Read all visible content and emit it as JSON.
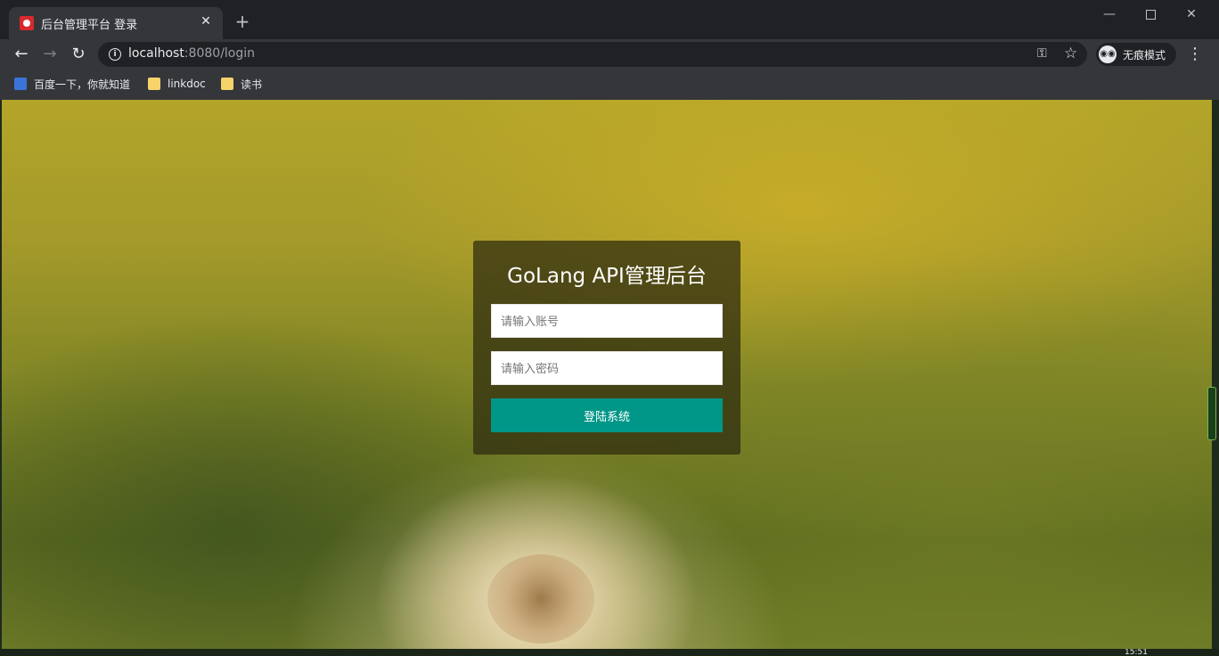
{
  "browser": {
    "tab_title": "后台管理平台 登录",
    "url_host": "localhost",
    "url_rest": ":8080/login",
    "incognito_label": "无痕模式",
    "bookmarks": [
      {
        "label": "百度一下，你就知道",
        "icon": "baidu-icon"
      },
      {
        "label": "linkdoc",
        "icon": "folder-icon"
      },
      {
        "label": "读书",
        "icon": "folder-icon"
      }
    ]
  },
  "login": {
    "title": "GoLang API管理后台",
    "username_placeholder": "请输入账号",
    "password_placeholder": "请输入密码",
    "submit_label": "登陆系统"
  },
  "taskbar": {
    "clock": "15:51"
  },
  "colors": {
    "button": "#009688",
    "panel": "rgba(45,42,15,0.72)",
    "chrome_dark": "#202124",
    "chrome": "#35363a"
  }
}
